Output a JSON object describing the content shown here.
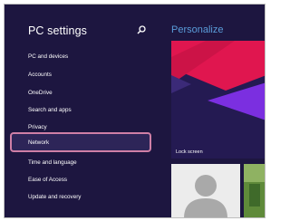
{
  "sidebar": {
    "title": "PC settings",
    "items": [
      {
        "label": "PC and devices"
      },
      {
        "label": "Accounts"
      },
      {
        "label": "OneDrive"
      },
      {
        "label": "Search and apps"
      },
      {
        "label": "Privacy"
      },
      {
        "label": "Network"
      },
      {
        "label": "Time and language"
      },
      {
        "label": "Ease of Access"
      },
      {
        "label": "Update and recovery"
      }
    ],
    "selected_item": "Network"
  },
  "content": {
    "heading": "Personalize",
    "lock_screen_label": "Lock screen"
  },
  "colors": {
    "background": "#1d1640",
    "accent_blue": "#5a9cd9",
    "highlight_border": "#cf7fa6",
    "tile_red": "#e0164f",
    "tile_purple": "#7b2fe0"
  },
  "icons": {
    "search": "search-icon",
    "account_avatar": "person-silhouette-icon"
  }
}
